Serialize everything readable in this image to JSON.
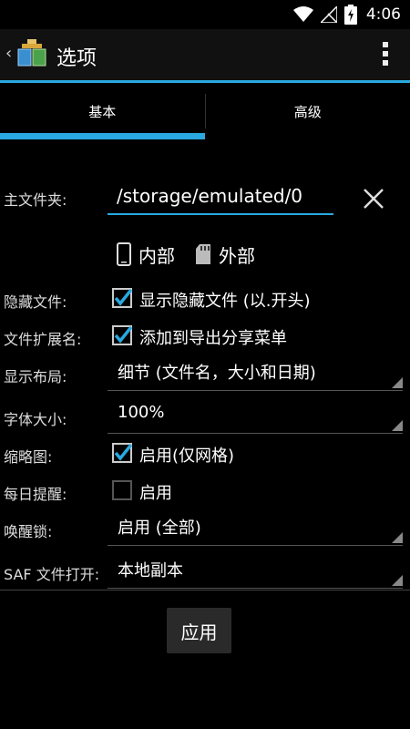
{
  "status_bar": {
    "time": "4:06",
    "battery_glyph": "4"
  },
  "action_bar": {
    "title": "选项"
  },
  "tabs": [
    {
      "label": "基本"
    },
    {
      "label": "高级"
    }
  ],
  "main_folder": {
    "label": "主文件夹:",
    "value": "/storage/emulated/0"
  },
  "storage": {
    "internal": "内部",
    "external": "外部"
  },
  "hidden_files": {
    "label": "隐藏文件:",
    "checked": true,
    "text": "显示隐藏文件 (以.开头)"
  },
  "file_extension": {
    "label": "文件扩展名:",
    "checked": true,
    "text": "添加到导出分享菜单"
  },
  "display_layout": {
    "label": "显示布局:",
    "value": "细节 (文件名，大小和日期)"
  },
  "font_size": {
    "label": "字体大小:",
    "value": "100%"
  },
  "thumbnails": {
    "label": "缩略图:",
    "checked": true,
    "text": "启用(仅网格)"
  },
  "daily_reminder": {
    "label": "每日提醒:",
    "checked": false,
    "text": "启用"
  },
  "wake_lock": {
    "label": "唤醒锁:",
    "value": "启用 (全部)"
  },
  "saf_open": {
    "label": "SAF 文件打开:",
    "value": "本地副本"
  },
  "apply_label": "应用",
  "colors": {
    "accent": "#29a9e0",
    "background": "#000000",
    "actionbar": "#111111"
  }
}
